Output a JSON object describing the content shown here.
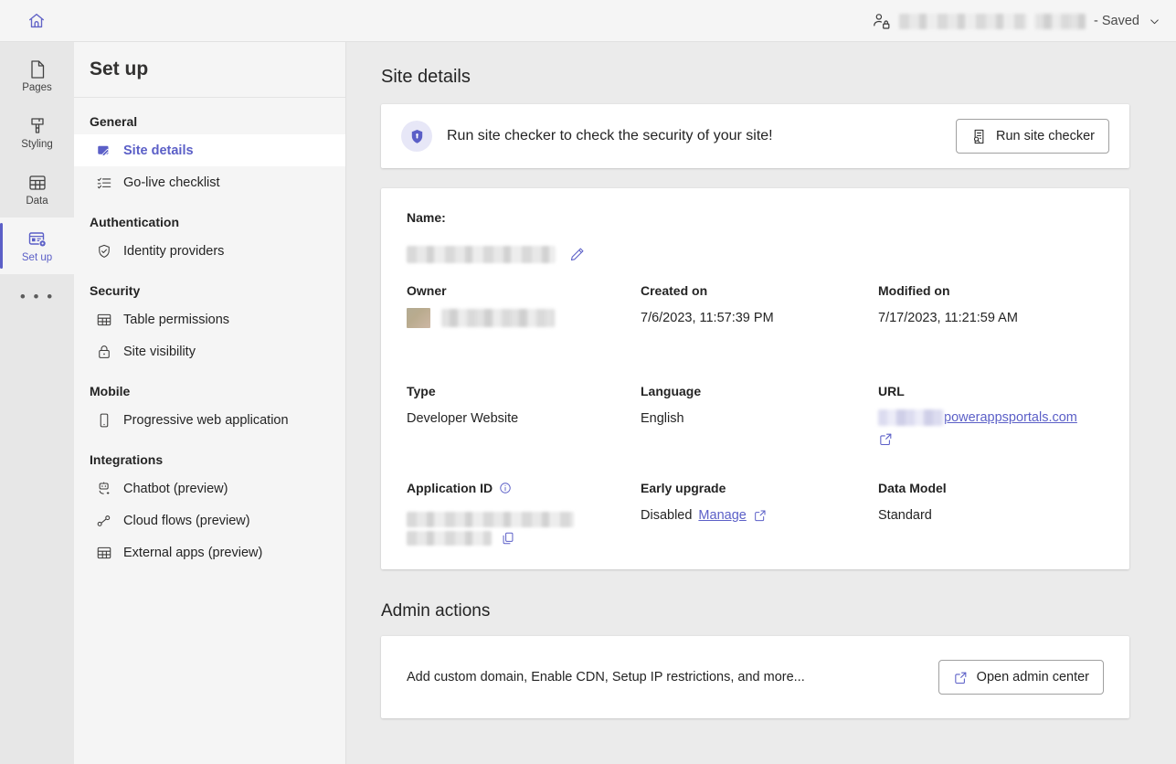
{
  "topbar": {
    "home_icon": "home-icon",
    "people_lock_icon": "people-lock-icon",
    "site_name_redacted": "",
    "env_name_redacted": "",
    "saved_label": "- Saved",
    "chevron": "⌄"
  },
  "rail": {
    "items": [
      {
        "label": "Pages",
        "icon": "page-icon",
        "active": false
      },
      {
        "label": "Styling",
        "icon": "paintbrush-icon",
        "active": false
      },
      {
        "label": "Data",
        "icon": "table-icon",
        "active": false
      },
      {
        "label": "Set up",
        "icon": "setup-icon",
        "active": true
      }
    ],
    "more_label": "• • •"
  },
  "panel": {
    "title": "Set up",
    "groups": [
      {
        "heading": "General",
        "items": [
          {
            "label": "Site details",
            "icon": "site-details-icon",
            "active": true
          },
          {
            "label": "Go-live checklist",
            "icon": "checklist-icon",
            "active": false
          }
        ]
      },
      {
        "heading": "Authentication",
        "items": [
          {
            "label": "Identity providers",
            "icon": "shield-check-icon",
            "active": false
          }
        ]
      },
      {
        "heading": "Security",
        "items": [
          {
            "label": "Table permissions",
            "icon": "table-icon",
            "active": false
          },
          {
            "label": "Site visibility",
            "icon": "lock-icon",
            "active": false
          }
        ]
      },
      {
        "heading": "Mobile",
        "items": [
          {
            "label": "Progressive web application",
            "icon": "phone-icon",
            "active": false
          }
        ]
      },
      {
        "heading": "Integrations",
        "items": [
          {
            "label": "Chatbot (preview)",
            "icon": "bot-icon",
            "active": false
          },
          {
            "label": "Cloud flows (preview)",
            "icon": "flow-icon",
            "active": false
          },
          {
            "label": "External apps (preview)",
            "icon": "table-icon",
            "active": false
          }
        ]
      }
    ]
  },
  "main": {
    "page_title": "Site details",
    "banner": {
      "icon": "shield-lock-icon",
      "message": "Run site checker to check the security of your site!",
      "button_label": "Run site checker",
      "button_icon": "document-search-icon"
    },
    "details": {
      "name_label": "Name:",
      "name_value_redacted": "",
      "edit_icon": "pencil-icon",
      "owner_label": "Owner",
      "owner_value_redacted": "",
      "created_on_label": "Created on",
      "created_on_value": "7/6/2023, 11:57:39 PM",
      "modified_on_label": "Modified on",
      "modified_on_value": "7/17/2023, 11:21:59 AM",
      "type_label": "Type",
      "type_value": "Developer Website",
      "language_label": "Language",
      "language_value": "English",
      "url_label": "URL",
      "url_prefix_redacted": "",
      "url_value": "powerappsportals.com",
      "url_open_icon": "open-in-new-icon",
      "application_id_label": "Application ID",
      "application_id_info_icon": "info-icon",
      "application_id_value_redacted": "",
      "copy_icon": "copy-icon",
      "early_upgrade_label": "Early upgrade",
      "early_upgrade_value": "Disabled",
      "early_upgrade_link": "Manage",
      "early_upgrade_link_icon": "open-in-new-icon",
      "data_model_label": "Data Model",
      "data_model_value": "Standard"
    },
    "admin": {
      "section_title": "Admin actions",
      "description": "Add custom domain, Enable CDN, Setup IP restrictions, and more...",
      "button_label": "Open admin center",
      "button_icon": "open-in-new-icon"
    }
  },
  "colors": {
    "accent": "#5b5fc7",
    "page_bg": "#ebebeb",
    "panel_bg": "#f5f5f5",
    "rail_bg": "#e7e7e7",
    "card_bg": "#ffffff",
    "text": "#242424"
  }
}
